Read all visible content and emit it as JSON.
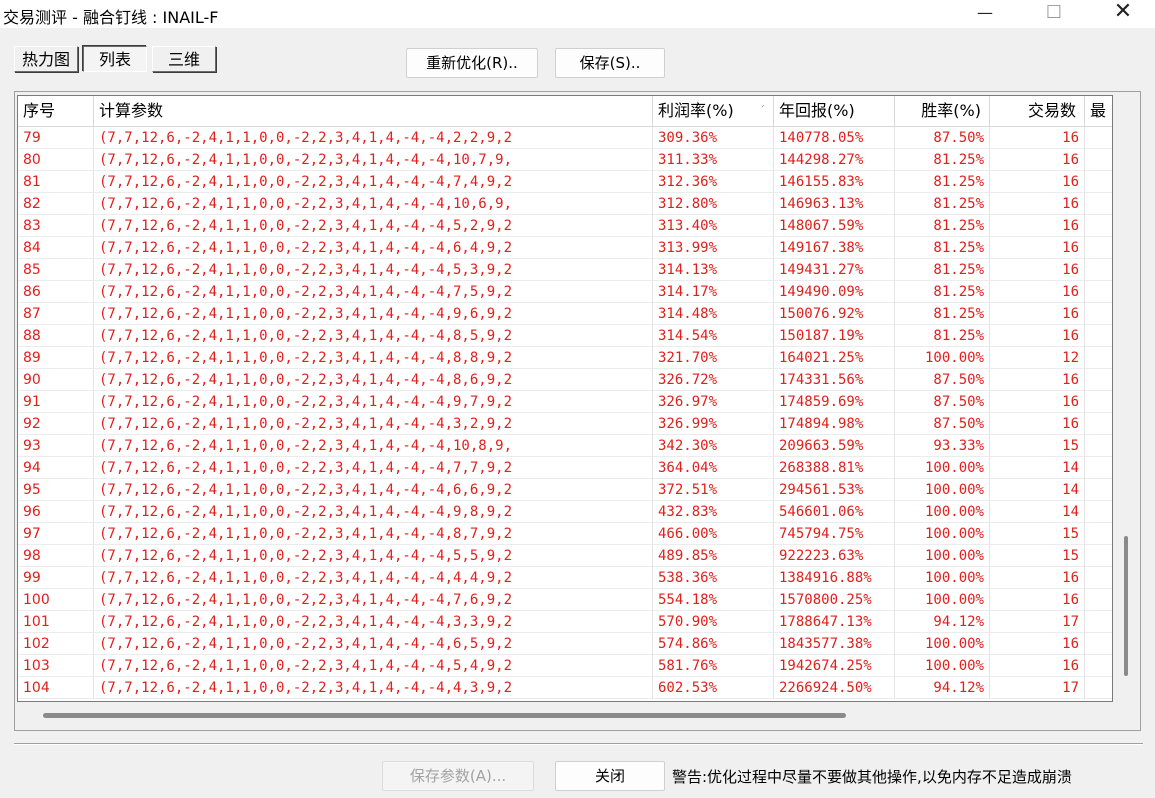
{
  "window": {
    "title": "交易测评 - 融合钉线 : INAIL-F",
    "min_icon": "—",
    "max_icon": "☐",
    "close_icon": "✕"
  },
  "view_tabs": [
    "热力图",
    "列表",
    "三维"
  ],
  "actions": {
    "reoptimize_label": "重新优化(R)..",
    "save_label": "保存(S).."
  },
  "table": {
    "columns": [
      "序号",
      "计算参数",
      "利润率(%)",
      "年回报(%)",
      "胜率(%)",
      "交易数",
      "最"
    ],
    "sort_indicator": "ˊ",
    "rows": [
      [
        "79",
        "(7,7,12,6,-2,4,1,1,0,0,-2,2,3,4,1,4,-4,-4,2,2,9,2",
        "309.36%",
        "140778.05%",
        "87.50%",
        "16"
      ],
      [
        "80",
        "(7,7,12,6,-2,4,1,1,0,0,-2,2,3,4,1,4,-4,-4,10,7,9,",
        "311.33%",
        "144298.27%",
        "81.25%",
        "16"
      ],
      [
        "81",
        "(7,7,12,6,-2,4,1,1,0,0,-2,2,3,4,1,4,-4,-4,7,4,9,2",
        "312.36%",
        "146155.83%",
        "81.25%",
        "16"
      ],
      [
        "82",
        "(7,7,12,6,-2,4,1,1,0,0,-2,2,3,4,1,4,-4,-4,10,6,9,",
        "312.80%",
        "146963.13%",
        "81.25%",
        "16"
      ],
      [
        "83",
        "(7,7,12,6,-2,4,1,1,0,0,-2,2,3,4,1,4,-4,-4,5,2,9,2",
        "313.40%",
        "148067.59%",
        "81.25%",
        "16"
      ],
      [
        "84",
        "(7,7,12,6,-2,4,1,1,0,0,-2,2,3,4,1,4,-4,-4,6,4,9,2",
        "313.99%",
        "149167.38%",
        "81.25%",
        "16"
      ],
      [
        "85",
        "(7,7,12,6,-2,4,1,1,0,0,-2,2,3,4,1,4,-4,-4,5,3,9,2",
        "314.13%",
        "149431.27%",
        "81.25%",
        "16"
      ],
      [
        "86",
        "(7,7,12,6,-2,4,1,1,0,0,-2,2,3,4,1,4,-4,-4,7,5,9,2",
        "314.17%",
        "149490.09%",
        "81.25%",
        "16"
      ],
      [
        "87",
        "(7,7,12,6,-2,4,1,1,0,0,-2,2,3,4,1,4,-4,-4,9,6,9,2",
        "314.48%",
        "150076.92%",
        "81.25%",
        "16"
      ],
      [
        "88",
        "(7,7,12,6,-2,4,1,1,0,0,-2,2,3,4,1,4,-4,-4,8,5,9,2",
        "314.54%",
        "150187.19%",
        "81.25%",
        "16"
      ],
      [
        "89",
        "(7,7,12,6,-2,4,1,1,0,0,-2,2,3,4,1,4,-4,-4,8,8,9,2",
        "321.70%",
        "164021.25%",
        "100.00%",
        "12"
      ],
      [
        "90",
        "(7,7,12,6,-2,4,1,1,0,0,-2,2,3,4,1,4,-4,-4,8,6,9,2",
        "326.72%",
        "174331.56%",
        "87.50%",
        "16"
      ],
      [
        "91",
        "(7,7,12,6,-2,4,1,1,0,0,-2,2,3,4,1,4,-4,-4,9,7,9,2",
        "326.97%",
        "174859.69%",
        "87.50%",
        "16"
      ],
      [
        "92",
        "(7,7,12,6,-2,4,1,1,0,0,-2,2,3,4,1,4,-4,-4,3,2,9,2",
        "326.99%",
        "174894.98%",
        "87.50%",
        "16"
      ],
      [
        "93",
        "(7,7,12,6,-2,4,1,1,0,0,-2,2,3,4,1,4,-4,-4,10,8,9,",
        "342.30%",
        "209663.59%",
        "93.33%",
        "15"
      ],
      [
        "94",
        "(7,7,12,6,-2,4,1,1,0,0,-2,2,3,4,1,4,-4,-4,7,7,9,2",
        "364.04%",
        "268388.81%",
        "100.00%",
        "14"
      ],
      [
        "95",
        "(7,7,12,6,-2,4,1,1,0,0,-2,2,3,4,1,4,-4,-4,6,6,9,2",
        "372.51%",
        "294561.53%",
        "100.00%",
        "14"
      ],
      [
        "96",
        "(7,7,12,6,-2,4,1,1,0,0,-2,2,3,4,1,4,-4,-4,9,8,9,2",
        "432.83%",
        "546601.06%",
        "100.00%",
        "14"
      ],
      [
        "97",
        "(7,7,12,6,-2,4,1,1,0,0,-2,2,3,4,1,4,-4,-4,8,7,9,2",
        "466.00%",
        "745794.75%",
        "100.00%",
        "15"
      ],
      [
        "98",
        "(7,7,12,6,-2,4,1,1,0,0,-2,2,3,4,1,4,-4,-4,5,5,9,2",
        "489.85%",
        "922223.63%",
        "100.00%",
        "15"
      ],
      [
        "99",
        "(7,7,12,6,-2,4,1,1,0,0,-2,2,3,4,1,4,-4,-4,4,4,9,2",
        "538.36%",
        "1384916.88%",
        "100.00%",
        "16"
      ],
      [
        "100",
        "(7,7,12,6,-2,4,1,1,0,0,-2,2,3,4,1,4,-4,-4,7,6,9,2",
        "554.18%",
        "1570800.25%",
        "100.00%",
        "16"
      ],
      [
        "101",
        "(7,7,12,6,-2,4,1,1,0,0,-2,2,3,4,1,4,-4,-4,3,3,9,2",
        "570.90%",
        "1788647.13%",
        "94.12%",
        "17"
      ],
      [
        "102",
        "(7,7,12,6,-2,4,1,1,0,0,-2,2,3,4,1,4,-4,-4,6,5,9,2",
        "574.86%",
        "1843577.38%",
        "100.00%",
        "16"
      ],
      [
        "103",
        "(7,7,12,6,-2,4,1,1,0,0,-2,2,3,4,1,4,-4,-4,5,4,9,2",
        "581.76%",
        "1942674.25%",
        "100.00%",
        "16"
      ],
      [
        "104",
        "(7,7,12,6,-2,4,1,1,0,0,-2,2,3,4,1,4,-4,-4,4,3,9,2",
        "602.53%",
        "2266924.50%",
        "94.12%",
        "17"
      ]
    ]
  },
  "footer": {
    "save_params_label": "保存参数(A)...",
    "close_label": "关闭",
    "warning": "警告:优化过程中尽量不要做其他操作,以免内存不足造成崩溃"
  },
  "colors": {
    "row_text": "#e0201c",
    "window_bg": "#f0f0f0"
  }
}
